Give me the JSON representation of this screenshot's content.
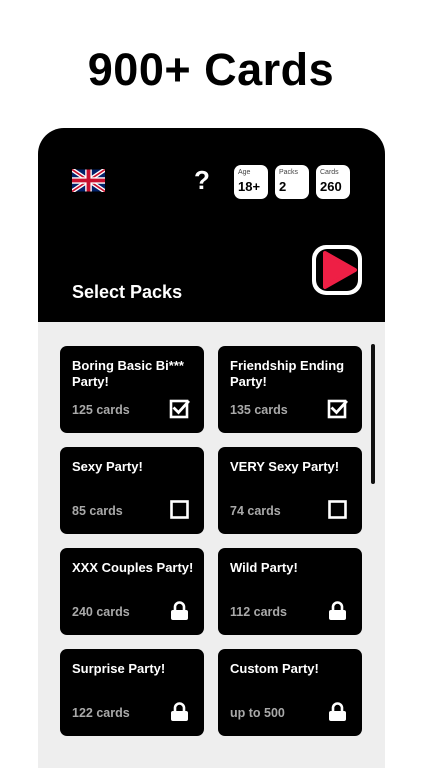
{
  "headline": "900+ Cards",
  "header": {
    "help_label": "?",
    "stats": [
      {
        "label": "Age",
        "value": "18+"
      },
      {
        "label": "Packs",
        "value": "2"
      },
      {
        "label": "Cards",
        "value": "260"
      }
    ],
    "section_title": "Select Packs"
  },
  "colors": {
    "play_accent": "#ee1f45",
    "header_bg": "#000000",
    "card_bg": "#000000",
    "list_bg": "#eeeeee"
  },
  "packs": [
    {
      "title": "Boring Basic Bi*** Party!",
      "count": "125 cards",
      "state": "checked",
      "icon": "checkbox-checked-icon"
    },
    {
      "title": "Friendship Ending Party!",
      "count": "135 cards",
      "state": "checked",
      "icon": "checkbox-checked-icon"
    },
    {
      "title": "Sexy Party!",
      "count": "85 cards",
      "state": "unchecked",
      "icon": "checkbox-empty-icon"
    },
    {
      "title": "VERY Sexy Party!",
      "count": "74 cards",
      "state": "unchecked",
      "icon": "checkbox-empty-icon"
    },
    {
      "title": "XXX Couples Party!",
      "count": "240 cards",
      "state": "locked",
      "icon": "lock-icon"
    },
    {
      "title": "Wild Party!",
      "count": "112 cards",
      "state": "locked",
      "icon": "lock-icon"
    },
    {
      "title": "Surprise Party!",
      "count": "122 cards",
      "state": "locked",
      "icon": "lock-icon"
    },
    {
      "title": "Custom Party!",
      "count": "up to 500",
      "state": "locked",
      "icon": "lock-icon"
    }
  ]
}
